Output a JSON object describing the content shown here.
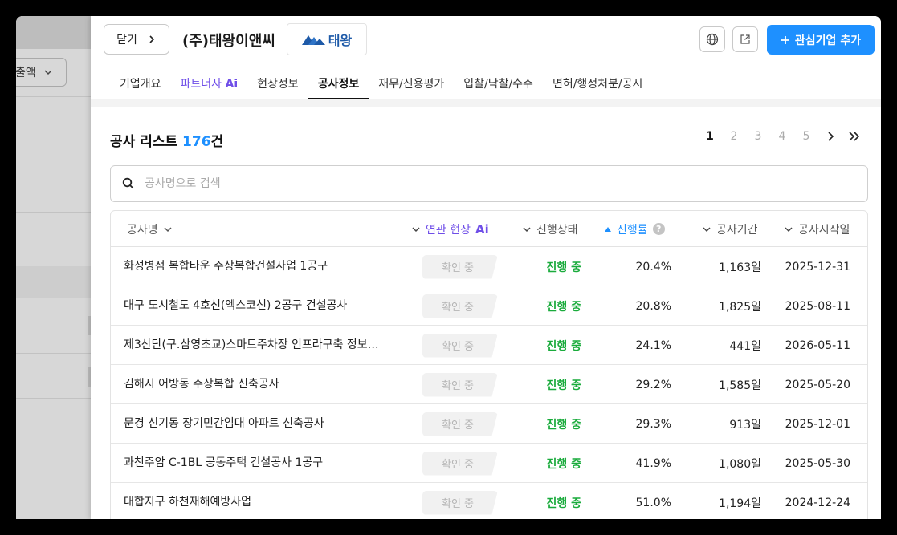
{
  "background_page": {
    "dropdown_label": "출액"
  },
  "header": {
    "close_label": "닫기",
    "company_name": "(주)태왕이앤씨",
    "logo_text": "태왕",
    "add_interest_label": "관심기업 추가"
  },
  "tabs": [
    {
      "label": "기업개요"
    },
    {
      "label": "파트너사",
      "suffix": "Ai"
    },
    {
      "label": "현장정보"
    },
    {
      "label": "공사정보",
      "active": true
    },
    {
      "label": "재무/신용평가"
    },
    {
      "label": "입찰/낙찰/수주"
    },
    {
      "label": "면허/행정처분/공시"
    }
  ],
  "list": {
    "title": "공사 리스트",
    "count": "176",
    "count_suffix": "건"
  },
  "pagination": {
    "pages": [
      "1",
      "2",
      "3",
      "4",
      "5"
    ],
    "current": "1"
  },
  "search": {
    "placeholder": "공사명으로 검색",
    "value": ""
  },
  "table": {
    "headers": {
      "name": "공사명",
      "related": "연관 현장",
      "related_suffix": "Ai",
      "status": "진행상태",
      "progress": "진행률",
      "progress_help": "?",
      "period": "공사기간",
      "start": "공사시작일"
    },
    "rows": [
      {
        "name": "화성병점 복합타운 주상복합건설사업 1공구",
        "related": "확인 중",
        "status": "진행 중",
        "progress": "20.4%",
        "period": "1,163일",
        "start": "2025-12-31"
      },
      {
        "name": "대구 도시철도 4호선(엑스코선) 2공구 건설공사",
        "related": "확인 중",
        "status": "진행 중",
        "progress": "20.8%",
        "period": "1,825일",
        "start": "2025-08-11"
      },
      {
        "name": "제3산단(구.삼영초교)스마트주차장 인프라구축 정보…",
        "related": "확인 중",
        "status": "진행 중",
        "progress": "24.1%",
        "period": "441일",
        "start": "2026-05-11"
      },
      {
        "name": "김해시 어방동 주상복합 신축공사",
        "related": "확인 중",
        "status": "진행 중",
        "progress": "29.2%",
        "period": "1,585일",
        "start": "2025-05-20"
      },
      {
        "name": "문경 신기동 장기민간임대 아파트 신축공사",
        "related": "확인 중",
        "status": "진행 중",
        "progress": "29.3%",
        "period": "913일",
        "start": "2025-12-01"
      },
      {
        "name": "과천주암 C-1BL 공동주택 건설공사 1공구",
        "related": "확인 중",
        "status": "진행 중",
        "progress": "41.9%",
        "period": "1,080일",
        "start": "2025-05-30"
      },
      {
        "name": "대합지구 하천재해예방사업",
        "related": "확인 중",
        "status": "진행 중",
        "progress": "51.0%",
        "period": "1,194일",
        "start": "2024-12-24"
      }
    ]
  },
  "colors": {
    "accent_blue": "#1e90ff",
    "ai_purple": "#6f4ee8",
    "status_green": "#1aab3c"
  },
  "icons": [
    "chevron-right-icon",
    "globe-icon",
    "external-link-icon",
    "plus-icon",
    "search-icon",
    "chevron-down-icon",
    "sort-up-icon",
    "help-icon",
    "double-chevron-right-icon"
  ]
}
